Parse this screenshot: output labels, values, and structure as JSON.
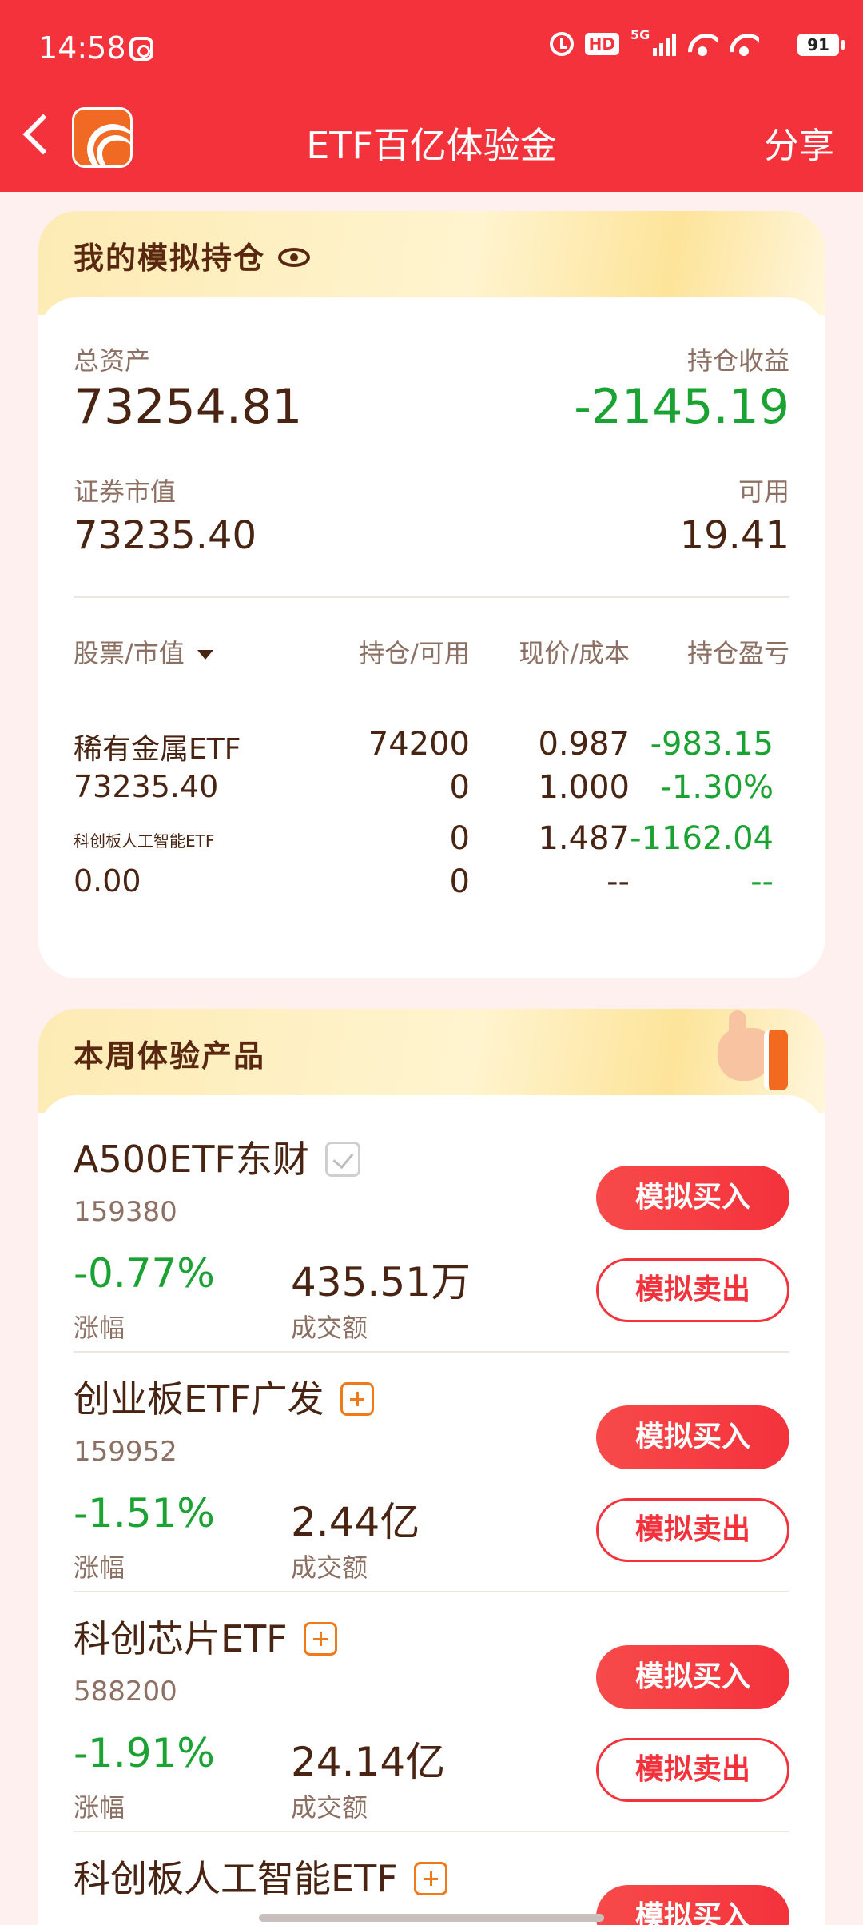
{
  "status_bar": {
    "time": "14:58",
    "network": "5G",
    "hd": "HD",
    "battery": "91"
  },
  "nav": {
    "title": "ETF百亿体验金",
    "share": "分享"
  },
  "holdings": {
    "title": "我的模拟持仓",
    "total_assets_label": "总资产",
    "total_assets": "73254.81",
    "position_pl_label": "持仓收益",
    "position_pl": "-2145.19",
    "market_value_label": "证券市值",
    "market_value": "73235.40",
    "available_label": "可用",
    "available": "19.41",
    "columns": [
      "股票/市值",
      "持仓/可用",
      "现价/成本",
      "持仓盈亏"
    ],
    "rows": [
      {
        "name": "稀有金属ETF",
        "value": "73235.40",
        "position": "74200",
        "available": "0",
        "price": "0.987",
        "cost": "1.000",
        "pl": "-983.15",
        "pl_pct": "-1.30%"
      },
      {
        "name": "科创板人工智能ETF",
        "value": "0.00",
        "position": "0",
        "available": "0",
        "price": "1.487",
        "cost": "--",
        "pl": "-1162.04",
        "pl_pct": "--"
      }
    ]
  },
  "products": {
    "title": "本周体验产品",
    "change_label": "涨幅",
    "volume_label": "成交额",
    "buy_label": "模拟买入",
    "sell_label": "模拟卖出",
    "items": [
      {
        "name": "A500ETF东财",
        "code": "159380",
        "change": "-0.77%",
        "volume": "435.51万",
        "added": true
      },
      {
        "name": "创业板ETF广发",
        "code": "159952",
        "change": "-1.51%",
        "volume": "2.44亿",
        "added": false
      },
      {
        "name": "科创芯片ETF",
        "code": "588200",
        "change": "-1.91%",
        "volume": "24.14亿",
        "added": false
      },
      {
        "name": "科创板人工智能ETF",
        "code": "",
        "change": "",
        "volume": "",
        "added": false
      }
    ]
  },
  "colors": {
    "brand_red": "#f4323c",
    "gain_green": "#1aa332",
    "text_brown": "#4a2412",
    "label_gray": "#8d7064"
  }
}
